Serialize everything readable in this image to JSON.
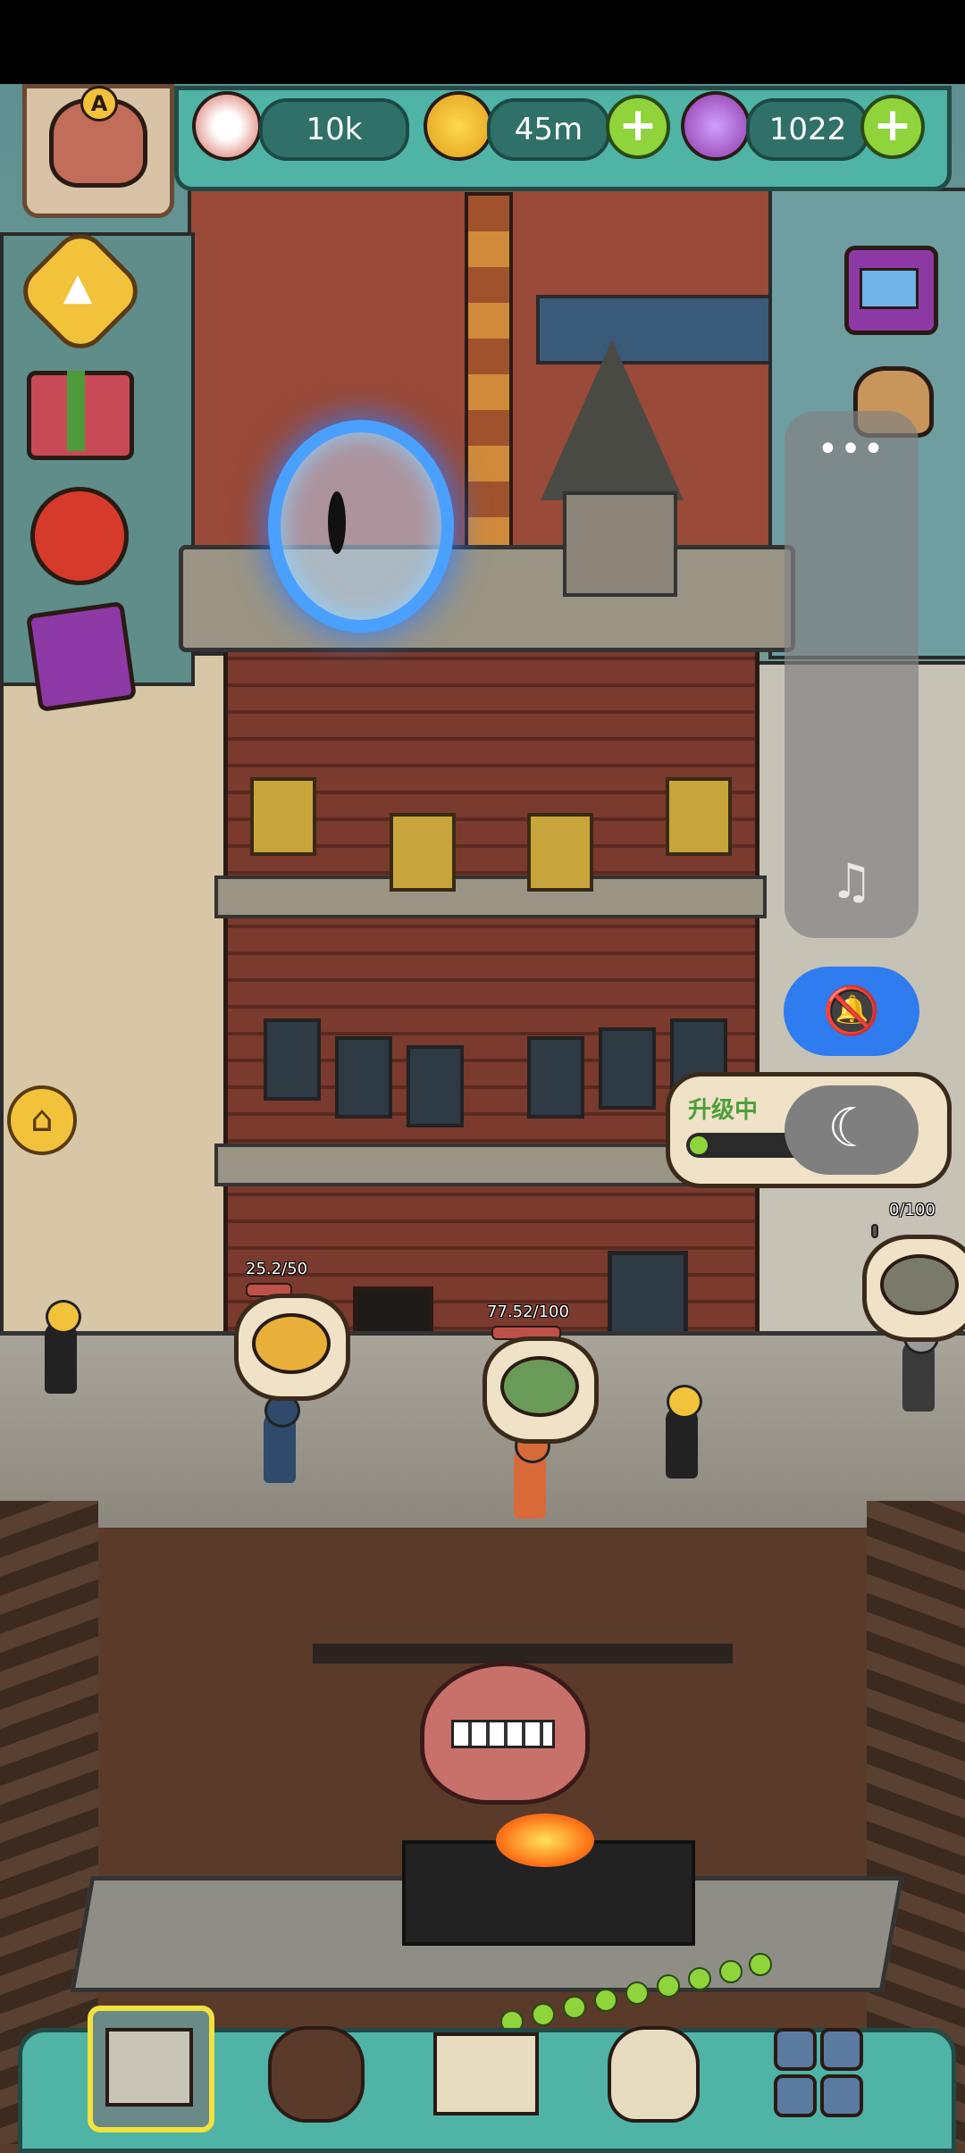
{
  "hud": {
    "avatar_letter": "A",
    "eyeballs": "10k",
    "coins": "45m",
    "potions": "1022",
    "plus_symbol": "+"
  },
  "side_buttons": {
    "up_arrow": "▲",
    "home_symbol": "⌂"
  },
  "panel": {
    "more_symbol": "•••",
    "music_symbol": "♫",
    "bell_symbol": "🔕",
    "moon_symbol": "☾"
  },
  "upgrade": {
    "label": "升级中",
    "progress": 0.08
  },
  "shops": [
    {
      "label": "25.2/50",
      "health": 0.504
    },
    {
      "label": "77.52/100",
      "health": 0.775
    },
    {
      "label": "0/100",
      "health": 0.0
    }
  ],
  "colors": {
    "hud_teal": "#4fb3a6",
    "accent_green": "#8fd43a",
    "gold": "#f2c23b",
    "bell_blue": "#2f7bf0"
  },
  "icons": {
    "eyeball": "eyeball-icon",
    "coin": "coin-icon",
    "potion": "potion-icon"
  }
}
